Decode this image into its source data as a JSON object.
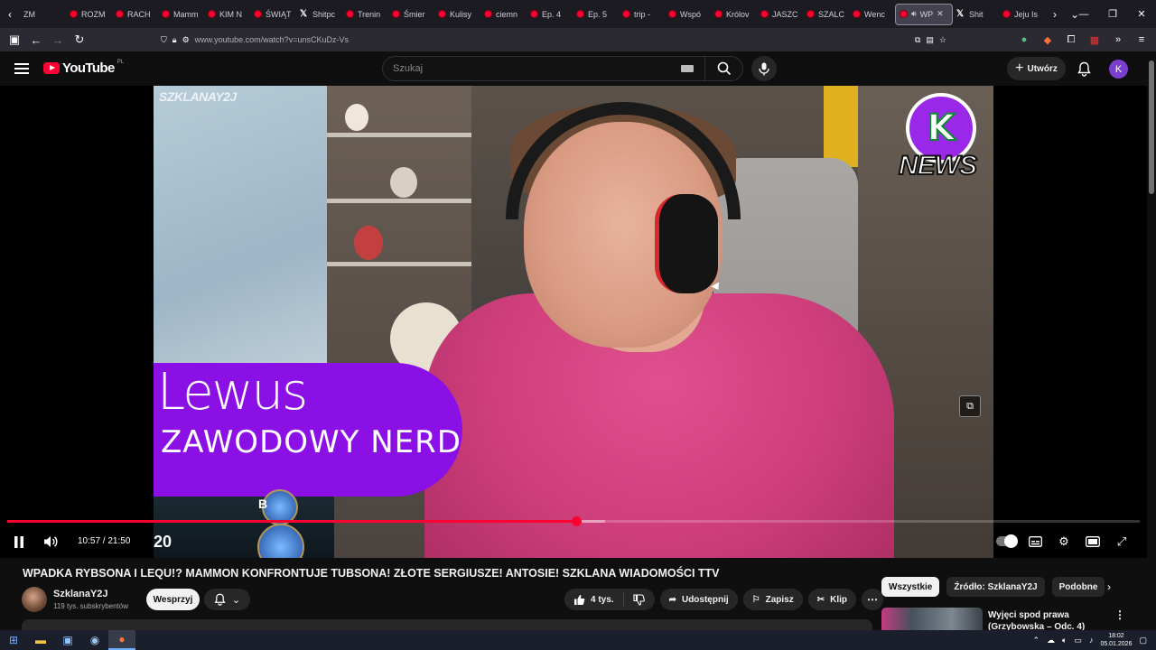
{
  "browser": {
    "tabs": [
      {
        "label": "ZM",
        "icon": "partial"
      },
      {
        "label": "ROZM",
        "icon": "youtube"
      },
      {
        "label": "RACH",
        "icon": "youtube"
      },
      {
        "label": "Mamm",
        "icon": "youtube"
      },
      {
        "label": "KIM N",
        "icon": "youtube"
      },
      {
        "label": "ŚWIĄT",
        "icon": "youtube"
      },
      {
        "label": "Shitpc",
        "icon": "x"
      },
      {
        "label": "Trenin",
        "icon": "youtube"
      },
      {
        "label": "Śmier",
        "icon": "youtube"
      },
      {
        "label": "Kulisy",
        "icon": "youtube"
      },
      {
        "label": "ciemn",
        "icon": "youtube"
      },
      {
        "label": "Ep. 4",
        "icon": "youtube"
      },
      {
        "label": "Ep. 5",
        "icon": "youtube"
      },
      {
        "label": "trip -",
        "icon": "youtube"
      },
      {
        "label": "Wspó",
        "icon": "youtube"
      },
      {
        "label": "Królov",
        "icon": "youtube"
      },
      {
        "label": "JASZC",
        "icon": "youtube"
      },
      {
        "label": "SZALC",
        "icon": "youtube"
      },
      {
        "label": "Wenc",
        "icon": "youtube"
      },
      {
        "label": "WP",
        "icon": "youtube",
        "active": true
      },
      {
        "label": "Shit",
        "icon": "x"
      },
      {
        "label": "Jeju Is",
        "icon": "youtube"
      }
    ],
    "url": "www.youtube.com/watch?v=unsCKuDz-Vs"
  },
  "youtube": {
    "logo_text": "YouTube",
    "region": "PL",
    "search_placeholder": "Szukaj",
    "create_label": "Utwórz",
    "avatar_letter": "K"
  },
  "video": {
    "overlay": {
      "watermark": "SZKLANAY2J",
      "badge_text": "NEWS",
      "nameplate_name": "Lewus",
      "nameplate_sub": "ZAWODOWY NERD",
      "game_letter": "B",
      "game_number": "20"
    },
    "current_time": "10:57",
    "duration": "21:50",
    "progress_fraction": 0.502,
    "buffer_fraction": 0.528,
    "title": "WPADKA RYBSONA I LEQU!? MAMMON KONFRONTUJE TUBSONA! ZŁOTE SERGIUSZE! ANTOSIE! SZKLANA WIADOMOŚCI TTV"
  },
  "channel": {
    "name": "SzklanaY2J",
    "subscribers": "119 tys. subskrybentów",
    "support_label": "Wesprzyj"
  },
  "actions": {
    "likes": "4 tys.",
    "share": "Udostępnij",
    "save": "Zapisz",
    "clip": "Klip"
  },
  "chips": [
    "Wszystkie",
    "Źródło: SzklanaY2J",
    "Podobne"
  ],
  "recommended": {
    "title": "Wyjęci spod prawa (Grzybowska – Odc. 4)"
  },
  "taskbar": {
    "time": "18:02",
    "date": "05.01.2026"
  }
}
